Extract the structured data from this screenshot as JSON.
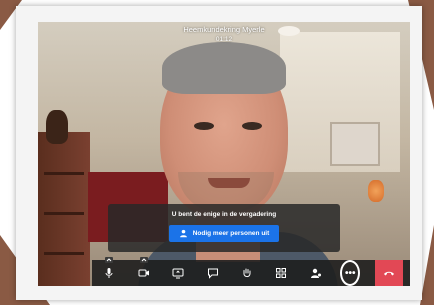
{
  "meeting": {
    "title": "Heemkundekring Myerle",
    "timer": "01:12"
  },
  "notice": {
    "message": "U bent de enige in de vergadering",
    "invite_label": "Nodig meer personen uit"
  },
  "toolbar": {
    "buttons": [
      {
        "icon": "microphone-icon"
      },
      {
        "icon": "camera-icon"
      },
      {
        "icon": "screen-share-icon"
      },
      {
        "icon": "chat-icon"
      },
      {
        "icon": "raise-hand-icon"
      },
      {
        "icon": "tile-view-icon"
      },
      {
        "icon": "participants-icon"
      },
      {
        "icon": "more-options-icon",
        "label": "•••"
      },
      {
        "icon": "hang-up-icon"
      }
    ]
  },
  "colors": {
    "invite_button": "#1b73e8",
    "hangup_button": "#e24855",
    "toolbar_bg": "#1e1e1e",
    "frame_background": "#8a5a44"
  }
}
